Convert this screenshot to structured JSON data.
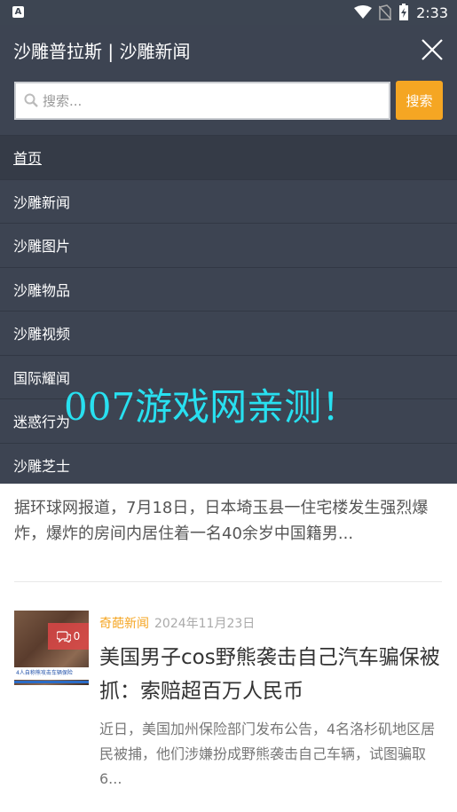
{
  "status_bar": {
    "app_indicator": "A",
    "time": "2:33"
  },
  "drawer": {
    "title": "沙雕普拉斯 | 沙雕新闻",
    "search": {
      "placeholder": "搜索...",
      "button_label": "搜索"
    },
    "nav_items": [
      {
        "label": "首页",
        "active": true
      },
      {
        "label": "沙雕新闻"
      },
      {
        "label": "沙雕图片"
      },
      {
        "label": "沙雕物品"
      },
      {
        "label": "沙雕视频"
      },
      {
        "label": "国际耀闻"
      },
      {
        "label": "迷惑行为"
      },
      {
        "label": "沙雕芝士"
      }
    ]
  },
  "watermark": "007游戏网亲测！",
  "feed": {
    "prev_excerpt": "据环球网报道，7月18日，日本埼玉县一住宅楼发生强烈爆炸，爆炸的房间内居住着一名40余岁中国籍男...",
    "article": {
      "category": "奇葩新闻",
      "date": "2024年11月23日",
      "comment_count": "0",
      "thumb_caption": "4人自称熊攻击车辆保险",
      "title": "美国男子cos野熊袭击自己汽车骗保被抓：索赔超百万人民币",
      "excerpt": "近日，美国加州保险部门发布公告，4名洛杉矶地区居民被捕，他们涉嫌扮成野熊袭击自己车辆，试图骗取6..."
    }
  },
  "colors": {
    "drawer_bg": "#3d4452",
    "accent": "#f5a623",
    "watermark": "#28e0f0"
  }
}
